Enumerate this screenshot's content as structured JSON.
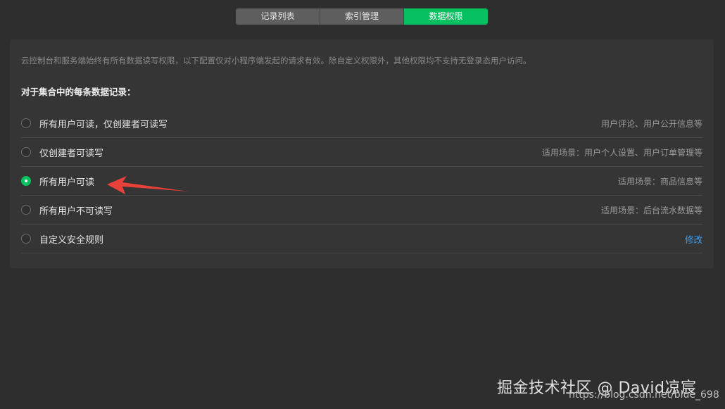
{
  "tabs": [
    {
      "label": "记录列表",
      "active": false
    },
    {
      "label": "索引管理",
      "active": false
    },
    {
      "label": "数据权限",
      "active": true
    }
  ],
  "notice": "云控制台和服务端始终有所有数据读写权限，以下配置仅对小程序端发起的请求有效。除自定义权限外，其他权限均不支持无登录态用户访问。",
  "section_title": "对于集合中的每条数据记录：",
  "options": [
    {
      "label": "所有用户可读，仅创建者可读写",
      "desc": "用户评论、用户公开信息等",
      "checked": false
    },
    {
      "label": "仅创建者可读写",
      "desc": "适用场景：用户个人设置、用户订单管理等",
      "checked": false
    },
    {
      "label": "所有用户可读",
      "desc": "适用场景：商品信息等",
      "checked": true
    },
    {
      "label": "所有用户不可读写",
      "desc": "适用场景：后台流水数据等",
      "checked": false
    },
    {
      "label": "自定义安全规则",
      "link": "修改",
      "checked": false
    }
  ],
  "watermark": "掘金技术社区 @ David凉宸",
  "url_mark": "https://blog.csdn.net/blue_698",
  "colors": {
    "accent": "#07c160",
    "link": "#3b9ff2",
    "annotation_arrow": "#e8413a"
  }
}
